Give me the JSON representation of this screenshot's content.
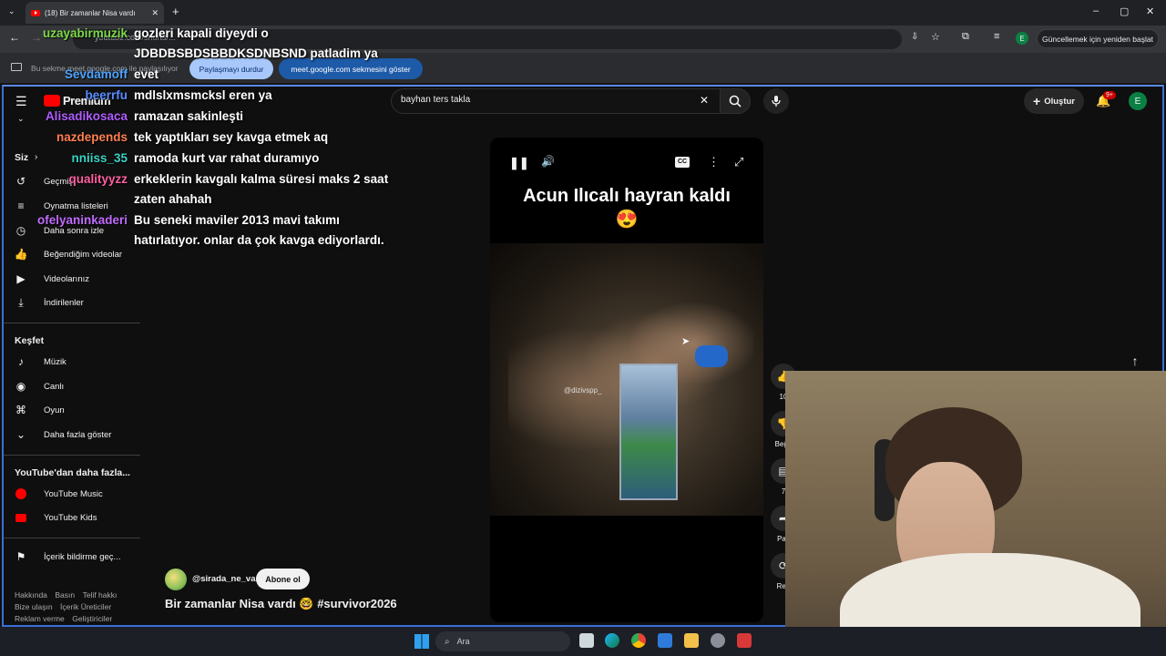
{
  "browser": {
    "tab_title": "(18) Bir zamanlar Nisa vardı",
    "url": "youtube.com/shorts/...",
    "update_button": "Güncellemek için yeniden başlat",
    "profile_letter": "E"
  },
  "sharebar": {
    "info": "Bu sekme meet.google.com ile paylaşılıyor",
    "stop_button": "Paylaşmayı durdur",
    "show_button": "meet.google.com sekmesini göster"
  },
  "youtube": {
    "logo": "Premium",
    "search_value": "bayhan ters takla",
    "create_label": "Oluştur",
    "notif_badge": "9+",
    "avatar_letter": "E"
  },
  "sidebar": {
    "you_header": "Siz",
    "you_items": [
      "Geçmiş",
      "Oynatma listeleri",
      "Daha sonra izle",
      "Beğendiğim videolar",
      "Videolarınız",
      "İndirilenler"
    ],
    "explore_header": "Keşfet",
    "explore_items": [
      "Müzik",
      "Canlı",
      "Oyun",
      "Daha fazla göster"
    ],
    "more_header": "YouTube'dan daha fazla...",
    "more_items": [
      "YouTube Music",
      "YouTube Kids"
    ],
    "report": "İçerik bildirme geç...",
    "footer": [
      "Hakkında",
      "Basın",
      "Telif hakkı",
      "Bize ulaşın",
      "İçerik Üreticiler",
      "Reklam verme",
      "Geliştiriciler"
    ]
  },
  "chat": [
    {
      "name": "uzayabirmuzik",
      "color": "#7cd94a",
      "text": "gozleri kapali diyeydi o"
    },
    {
      "name": "",
      "color": "#ffffff",
      "text": "JDBDBSBDSBBDKSDNBSND patladim ya"
    },
    {
      "name": "Sevdamoff",
      "color": "#4da3ff",
      "text": "evet"
    },
    {
      "name": "beerrfu",
      "color": "#5a8cff",
      "text": "mdlslxmsmcksl eren ya"
    },
    {
      "name": "Alisadikosaca",
      "color": "#b05cff",
      "text": "ramazan sakinleşti"
    },
    {
      "name": "nazdepends",
      "color": "#ff7f50",
      "text": "tek yaptıkları sey kavga etmek aq"
    },
    {
      "name": "nniiss_35",
      "color": "#3ad1c2",
      "text": "ramoda kurt var rahat duramıyo"
    },
    {
      "name": "qualityyzz",
      "color": "#ff5fa2",
      "text": "erkeklerin kavgalı kalma süresi maks 2 saat"
    },
    {
      "name": "",
      "color": "#ffffff",
      "text": "zaten ahahah"
    },
    {
      "name": "ofelyaninkaderi",
      "color": "#c06bff",
      "text": "Bu seneki maviler 2013 mavi takımı"
    },
    {
      "name": "",
      "color": "#ffffff",
      "text": "hatırlatıyor. onlar da çok kavga ediyorlardı."
    }
  ],
  "short": {
    "overlay_title": "Acun Ilıcalı hayran kaldı",
    "overlay_emoji": "😍",
    "watermark": "@dizivspp_",
    "channel": "@sirada_ne_var",
    "subscribe": "Abone ol",
    "title": "Bir zamanlar Nisa vardı 🤓 #survivor2026",
    "like_count": "10",
    "dislike_label": "Beğe",
    "comment_count": "7",
    "share_label": "Pay",
    "remix_label": "Ren"
  },
  "taskbar": {
    "search_label": "Ara"
  }
}
